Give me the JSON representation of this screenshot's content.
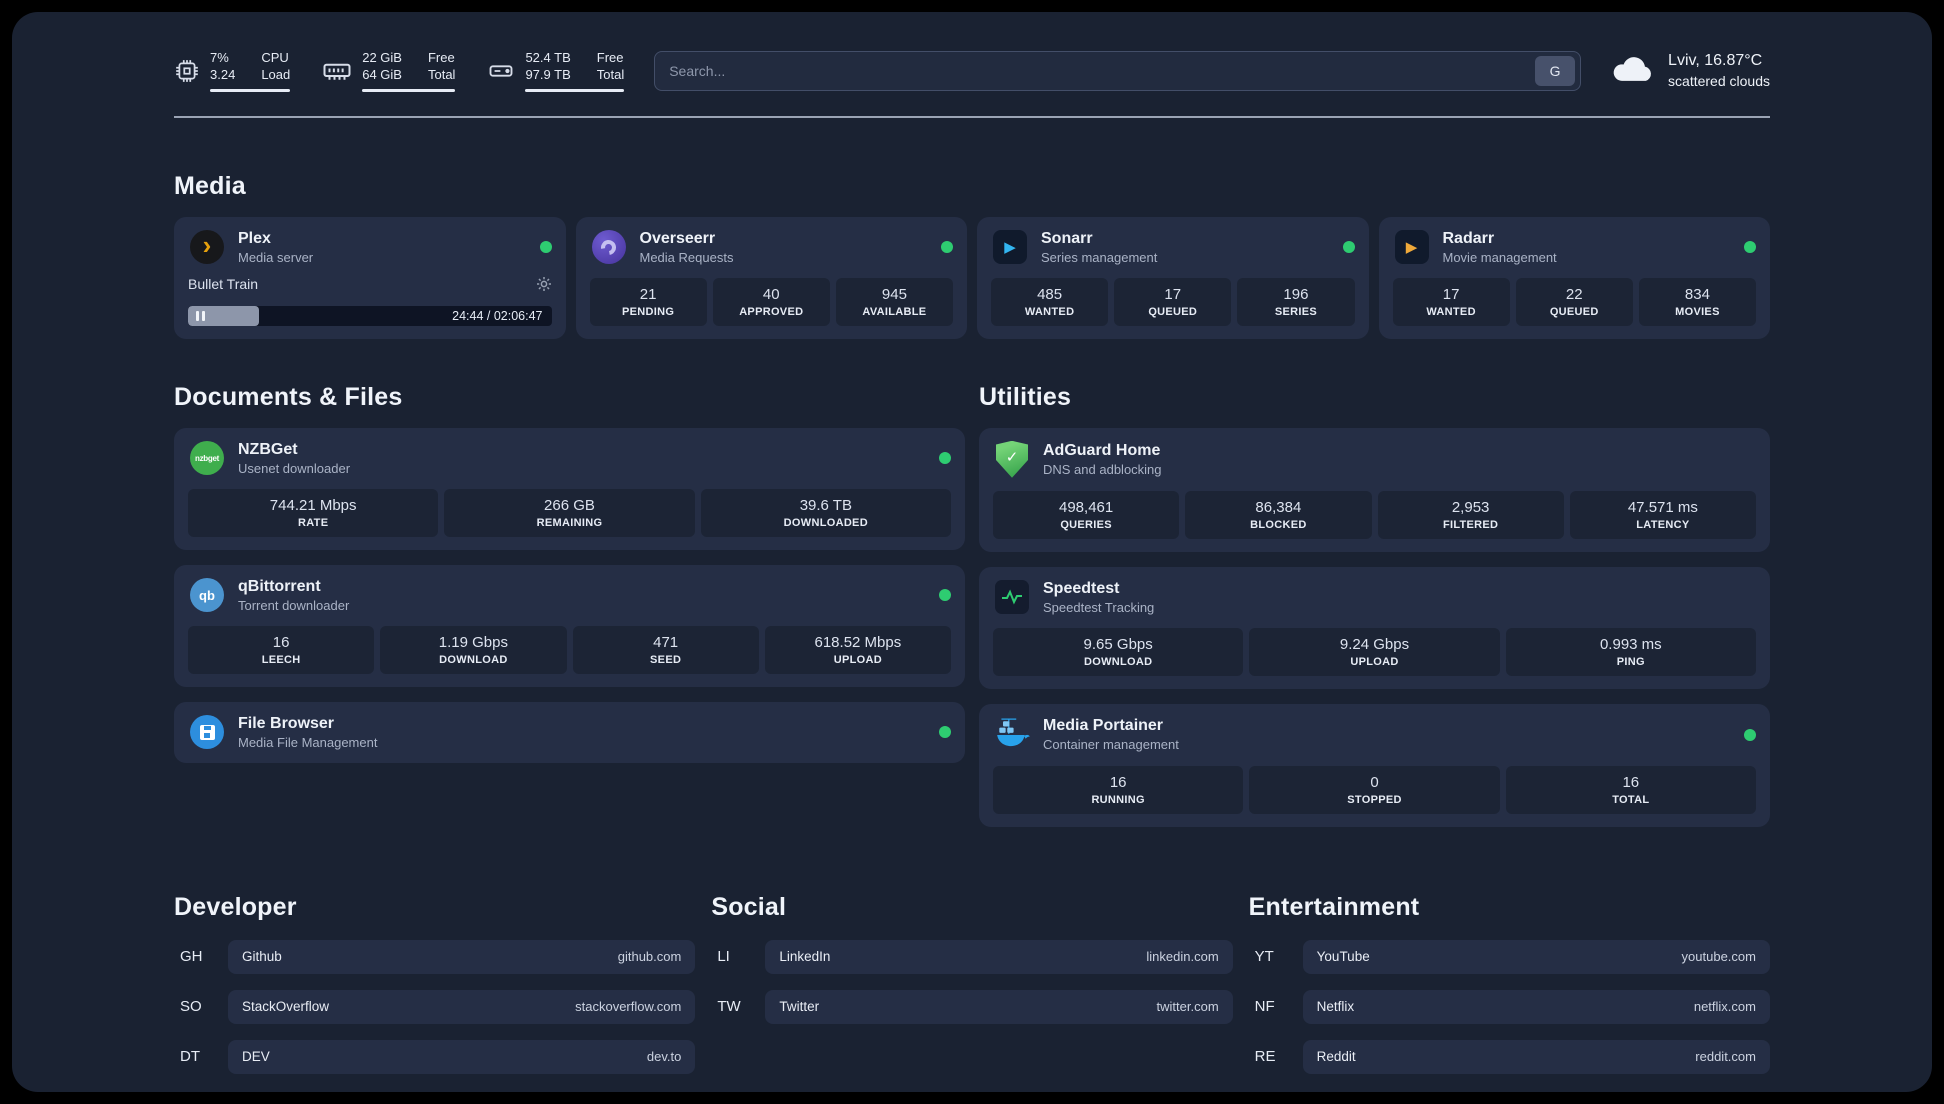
{
  "colors": {
    "page_bg": "#1a2232",
    "card_bg": "#252e45",
    "tile_bg": "#1c2435",
    "status_online": "#2ecc71",
    "accent_amber": "#e5a00d",
    "accent_blue": "#33b5f0"
  },
  "topbar": {
    "metrics": [
      {
        "id": "cpu",
        "icon": "cpu",
        "value_top": "7%",
        "value_bottom": "3.24",
        "label_top": "CPU",
        "label_bottom": "Load"
      },
      {
        "id": "ram",
        "icon": "ram",
        "value_top": "22 GiB",
        "value_bottom": "64 GiB",
        "label_top": "Free",
        "label_bottom": "Total"
      },
      {
        "id": "disk",
        "icon": "disk",
        "value_top": "52.4 TB",
        "value_bottom": "97.9 TB",
        "label_top": "Free",
        "label_bottom": "Total"
      }
    ],
    "search": {
      "placeholder": "Search...",
      "engine": "G"
    },
    "weather": {
      "location_temp": "Lviv, 16.87°C",
      "condition": "scattered clouds"
    }
  },
  "sections": {
    "media": {
      "title": "Media",
      "apps": [
        {
          "name": "Plex",
          "subtitle": "Media server",
          "icon": "plex",
          "status": "online",
          "now_playing": {
            "title": "Bullet Train",
            "time_display": "24:44 / 02:06:47",
            "elapsed": "24:44",
            "duration": "02:06:47",
            "progress_pct": 19.5
          }
        },
        {
          "name": "Overseerr",
          "subtitle": "Media Requests",
          "icon": "overseerr",
          "status": "online",
          "stats": [
            {
              "value": "21",
              "label": "PENDING"
            },
            {
              "value": "40",
              "label": "APPROVED"
            },
            {
              "value": "945",
              "label": "AVAILABLE"
            }
          ]
        },
        {
          "name": "Sonarr",
          "subtitle": "Series management",
          "icon": "sonarr",
          "status": "online",
          "stats": [
            {
              "value": "485",
              "label": "WANTED"
            },
            {
              "value": "17",
              "label": "QUEUED"
            },
            {
              "value": "196",
              "label": "SERIES"
            }
          ]
        },
        {
          "name": "Radarr",
          "subtitle": "Movie management",
          "icon": "radarr",
          "status": "online",
          "stats": [
            {
              "value": "17",
              "label": "WANTED"
            },
            {
              "value": "22",
              "label": "QUEUED"
            },
            {
              "value": "834",
              "label": "MOVIES"
            }
          ]
        }
      ]
    },
    "documents": {
      "title": "Documents & Files",
      "apps": [
        {
          "name": "NZBGet",
          "subtitle": "Usenet downloader",
          "icon": "nzbget",
          "status": "online",
          "stats": [
            {
              "value": "744.21 Mbps",
              "label": "RATE"
            },
            {
              "value": "266 GB",
              "label": "REMAINING"
            },
            {
              "value": "39.6 TB",
              "label": "DOWNLOADED"
            }
          ]
        },
        {
          "name": "qBittorrent",
          "subtitle": "Torrent downloader",
          "icon": "qbittorrent",
          "status": "online",
          "stats": [
            {
              "value": "16",
              "label": "LEECH"
            },
            {
              "value": "1.19 Gbps",
              "label": "DOWNLOAD"
            },
            {
              "value": "471",
              "label": "SEED"
            },
            {
              "value": "618.52 Mbps",
              "label": "UPLOAD"
            }
          ]
        },
        {
          "name": "File Browser",
          "subtitle": "Media File Management",
          "icon": "filebrowser",
          "status": "online",
          "stats": []
        }
      ]
    },
    "utilities": {
      "title": "Utilities",
      "apps": [
        {
          "name": "AdGuard Home",
          "subtitle": "DNS and adblocking",
          "icon": "adguard",
          "status": null,
          "stats": [
            {
              "value": "498,461",
              "label": "QUERIES"
            },
            {
              "value": "86,384",
              "label": "BLOCKED"
            },
            {
              "value": "2,953",
              "label": "FILTERED"
            },
            {
              "value": "47.571 ms",
              "label": "LATENCY"
            }
          ]
        },
        {
          "name": "Speedtest",
          "subtitle": "Speedtest Tracking",
          "icon": "speedtest",
          "status": null,
          "stats": [
            {
              "value": "9.65 Gbps",
              "label": "DOWNLOAD"
            },
            {
              "value": "9.24 Gbps",
              "label": "UPLOAD"
            },
            {
              "value": "0.993 ms",
              "label": "PING"
            }
          ]
        },
        {
          "name": "Media Portainer",
          "subtitle": "Container management",
          "icon": "portainer",
          "status": "online",
          "stats": [
            {
              "value": "16",
              "label": "RUNNING"
            },
            {
              "value": "0",
              "label": "STOPPED"
            },
            {
              "value": "16",
              "label": "TOTAL"
            }
          ]
        }
      ]
    }
  },
  "bookmarks": [
    {
      "title": "Developer",
      "links": [
        {
          "abbr": "GH",
          "name": "Github",
          "url": "github.com"
        },
        {
          "abbr": "SO",
          "name": "StackOverflow",
          "url": "stackoverflow.com"
        },
        {
          "abbr": "DT",
          "name": "DEV",
          "url": "dev.to"
        }
      ]
    },
    {
      "title": "Social",
      "links": [
        {
          "abbr": "LI",
          "name": "LinkedIn",
          "url": "linkedin.com"
        },
        {
          "abbr": "TW",
          "name": "Twitter",
          "url": "twitter.com"
        }
      ]
    },
    {
      "title": "Entertainment",
      "links": [
        {
          "abbr": "YT",
          "name": "YouTube",
          "url": "youtube.com"
        },
        {
          "abbr": "NF",
          "name": "Netflix",
          "url": "netflix.com"
        },
        {
          "abbr": "RE",
          "name": "Reddit",
          "url": "reddit.com"
        }
      ]
    }
  ]
}
